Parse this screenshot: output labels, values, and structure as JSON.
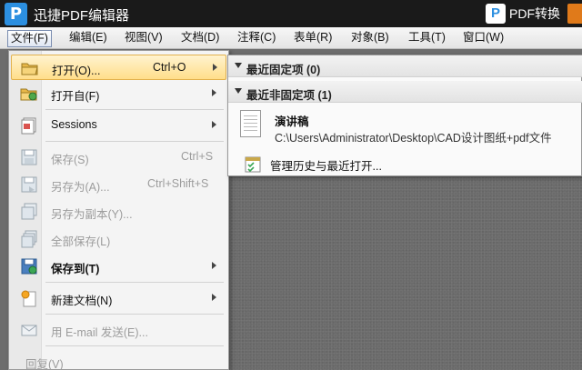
{
  "app": {
    "title": "迅捷PDF编辑器",
    "logo_letter": "P",
    "convert_logo_letter": "P",
    "convert_label": "PDF转换"
  },
  "menubar": {
    "items": [
      "文件(F)",
      "编辑(E)",
      "视图(V)",
      "文档(D)",
      "注释(C)",
      "表单(R)",
      "对象(B)",
      "工具(T)",
      "窗口(W)"
    ],
    "active_index": 0
  },
  "file_menu": {
    "items": [
      {
        "label": "打开(O)...",
        "shortcut": "Ctrl+O",
        "icon": "open-folder-icon",
        "submenu": true,
        "highlighted": true,
        "disabled": false
      },
      {
        "label": "打开自(F)",
        "shortcut": "",
        "icon": "open-from-folder-icon",
        "submenu": true,
        "highlighted": false,
        "disabled": false
      },
      {
        "label": "Sessions",
        "shortcut": "",
        "icon": "sessions-icon",
        "submenu": true,
        "highlighted": false,
        "disabled": false
      },
      {
        "label": "保存(S)",
        "shortcut": "Ctrl+S",
        "icon": "save-icon",
        "submenu": false,
        "highlighted": false,
        "disabled": true
      },
      {
        "label": "另存为(A)...",
        "shortcut": "Ctrl+Shift+S",
        "icon": "save-as-icon",
        "submenu": false,
        "highlighted": false,
        "disabled": true
      },
      {
        "label": "另存为副本(Y)...",
        "shortcut": "",
        "icon": "save-copy-icon",
        "submenu": false,
        "highlighted": false,
        "disabled": true
      },
      {
        "label": "全部保存(L)",
        "shortcut": "",
        "icon": "save-all-icon",
        "submenu": false,
        "highlighted": false,
        "disabled": true
      },
      {
        "label": "保存到(T)",
        "shortcut": "",
        "icon": "save-to-icon",
        "submenu": true,
        "highlighted": false,
        "disabled": false
      },
      {
        "label": "新建文档(N)",
        "shortcut": "",
        "icon": "new-document-icon",
        "submenu": true,
        "highlighted": false,
        "disabled": false
      },
      {
        "label": "用 E-mail 发送(E)...",
        "shortcut": "",
        "icon": "email-icon",
        "submenu": false,
        "highlighted": false,
        "disabled": true
      },
      {
        "label": "回复(V)",
        "shortcut": "",
        "icon": "",
        "submenu": false,
        "highlighted": false,
        "disabled": true
      }
    ]
  },
  "recent_panel": {
    "pinned_header": "最近固定项 (0)",
    "unpinned_header": "最近非固定项 (1)",
    "files": [
      {
        "name": "演讲稿",
        "path": "C:\\Users\\Administrator\\Desktop\\CAD设计图纸+pdf文件"
      }
    ],
    "manage_label": "管理历史与最近打开..."
  },
  "colors": {
    "titlebar": "#1a1a1a",
    "logo_blue": "#2c8fe0",
    "highlight": "#ffde8a",
    "workspace": "#6d6d6d"
  }
}
